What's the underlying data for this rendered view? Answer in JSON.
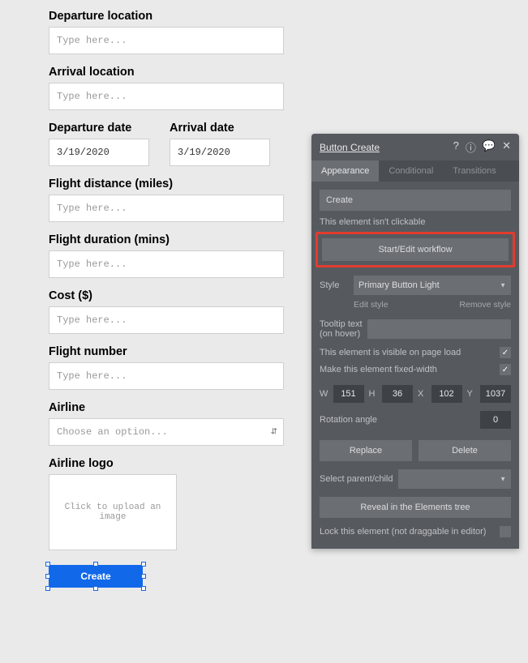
{
  "form": {
    "departure_location_label": "Departure location",
    "arrival_location_label": "Arrival location",
    "departure_date_label": "Departure date",
    "arrival_date_label": "Arrival date",
    "flight_distance_label": "Flight distance (miles)",
    "flight_duration_label": "Flight duration (mins)",
    "cost_label": "Cost ($)",
    "flight_number_label": "Flight number",
    "airline_label": "Airline",
    "airline_logo_label": "Airline logo",
    "placeholder_type": "Type here...",
    "date_value": "3/19/2020",
    "select_placeholder": "Choose an option...",
    "upload_placeholder": "Click to upload an image",
    "create_button": "Create"
  },
  "inspector": {
    "title": "Button Create",
    "tabs": {
      "appearance": "Appearance",
      "conditional": "Conditional",
      "transitions": "Transitions"
    },
    "element_name": "Create",
    "not_clickable_text": "This element isn't clickable",
    "workflow_button": "Start/Edit workflow",
    "style_label": "Style",
    "style_value": "Primary Button Light",
    "edit_style": "Edit style",
    "remove_style": "Remove style",
    "tooltip_label": "Tooltip text (on hover)",
    "visible_label": "This element is visible on page load",
    "fixed_width_label": "Make this element fixed-width",
    "dim": {
      "w_label": "W",
      "w": "151",
      "h_label": "H",
      "h": "36",
      "x_label": "X",
      "x": "102",
      "y_label": "Y",
      "y": "1037"
    },
    "rotation_label": "Rotation angle",
    "rotation_value": "0",
    "replace_btn": "Replace",
    "delete_btn": "Delete",
    "parent_label": "Select parent/child",
    "reveal_btn": "Reveal in the Elements tree",
    "lock_label": "Lock this element (not draggable in editor)"
  }
}
